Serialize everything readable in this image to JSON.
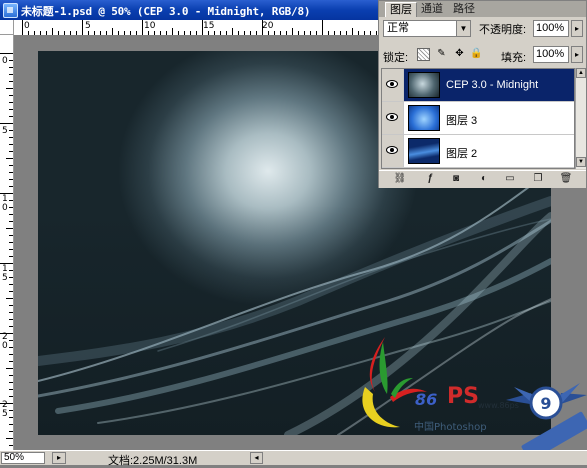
{
  "document": {
    "title": "未标题-1.psd @ 50% (CEP 3.0 - Midnight, RGB/8)"
  },
  "rulers": {
    "horizontal_labels": [
      "0",
      "5",
      "10",
      "15",
      "20"
    ],
    "vertical_labels": [
      "0",
      "5",
      "1\n0",
      "1\n5",
      "2\n0",
      "2\n5"
    ]
  },
  "status_bar": {
    "zoom": "50%",
    "doc_info": "文档:2.25M/31.3M"
  },
  "watermark": {
    "brand": "86",
    "ps": "PS",
    "cn_text": "中国Photoshop",
    "url": "www.86ps"
  },
  "layers_panel": {
    "tabs": [
      {
        "label": "图层",
        "active": true
      },
      {
        "label": "通道",
        "active": false
      },
      {
        "label": "路径",
        "active": false
      }
    ],
    "blend_mode": "正常",
    "opacity_label": "不透明度:",
    "opacity_value": "100%",
    "lock_label": "锁定:",
    "fill_label": "填充:",
    "fill_value": "100%",
    "layers": [
      {
        "name": "CEP 3.0 - Midnight",
        "selected": true,
        "visible": true
      },
      {
        "name": "图层 3",
        "selected": false,
        "visible": true
      },
      {
        "name": "图层 2",
        "selected": false,
        "visible": true
      }
    ],
    "bottom_icons": [
      "link-icon",
      "layer-style-icon",
      "add-mask-icon",
      "adjustment-layer-icon",
      "new-group-icon",
      "new-layer-icon",
      "trash-icon"
    ]
  }
}
